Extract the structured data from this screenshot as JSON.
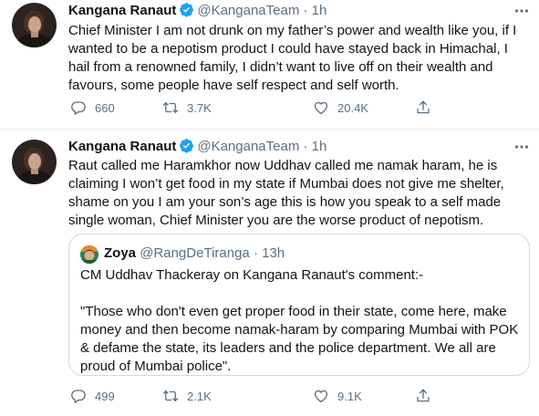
{
  "tweets": [
    {
      "display_name": "Kangana Ranaut",
      "handle": "@KanganaTeam",
      "separator": "·",
      "time": "1h",
      "text": "Chief Minister I am not drunk on my father’s power and wealth like you, if I wanted to be a nepotism product I could have stayed back in Himachal, I hail from a renowned family, I didn’t want to live off on their wealth and favours, some people have self respect and self worth.",
      "replies": "660",
      "retweets": "3.7K",
      "likes": "20.4K"
    },
    {
      "display_name": "Kangana Ranaut",
      "handle": "@KanganaTeam",
      "separator": "·",
      "time": "1h",
      "text": "Raut called me Haramkhor now Uddhav called me namak haram, he is claiming I won’t get food in my state if Mumbai does not give me shelter, shame on you I am your son’s age this is how you speak to a self made single woman, Chief Minister you are the worse product of nepotism.",
      "quote": {
        "display_name": "Zoya",
        "handle": "@RangDeTiranga",
        "separator": "·",
        "time": "13h",
        "line1": "CM Uddhav Thackeray on Kangana Ranaut's comment:-",
        "line2": "\"Those who don't even get proper food in their state, come here, make money and then become namak-haram by comparing Mumbai with POK & defame the state, its leaders and the police department. We all are proud of Mumbai police\"."
      },
      "replies": "499",
      "retweets": "2.1K",
      "likes": "9.1K"
    }
  ],
  "icons": {
    "verified": "verified-badge-icon",
    "more": "more-dots-icon",
    "reply": "reply-bubble-icon",
    "retweet": "retweet-arrows-icon",
    "like": "heart-outline-icon",
    "share": "share-upload-icon"
  },
  "colors": {
    "text": "#0f1419",
    "secondary": "#5b7083",
    "verified": "#1da1f2",
    "border": "#cfd9de"
  }
}
